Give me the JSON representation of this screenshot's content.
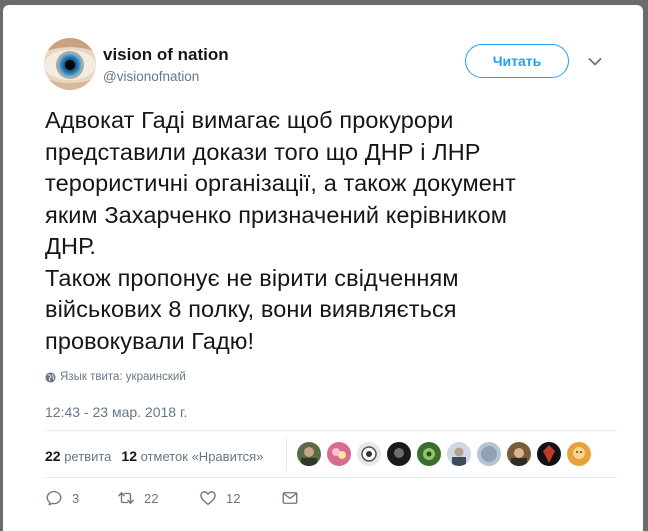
{
  "user": {
    "name": "vision of nation",
    "handle": "@visionofnation"
  },
  "follow_label": "Читать",
  "tweet": {
    "lines": [
      "Адвокат Гаді вимагає щоб прокурори",
      "представили докази того що ДНР і ЛНР",
      "терористичні організації, а також документ",
      "яким Захарченко призначений керівником",
      "ДНР.",
      "Також пропонує не вірити свідченням",
      "військових 8 полку, вони виявляється",
      "провокували Гадю!"
    ],
    "language": "Язык твита: украинский",
    "timestamp": "12:43 - 23 мар. 2018 г."
  },
  "stats": {
    "retweets_count": "22",
    "retweets_label": "ретвита",
    "likes_count": "12",
    "likes_label": "отметок «Нравится»"
  },
  "actions": {
    "reply_count": "3",
    "retweet_count": "22",
    "like_count": "12"
  },
  "colors": {
    "accent": "#1da1f2",
    "secondary_text": "#657786",
    "primary_text": "#14171a"
  }
}
